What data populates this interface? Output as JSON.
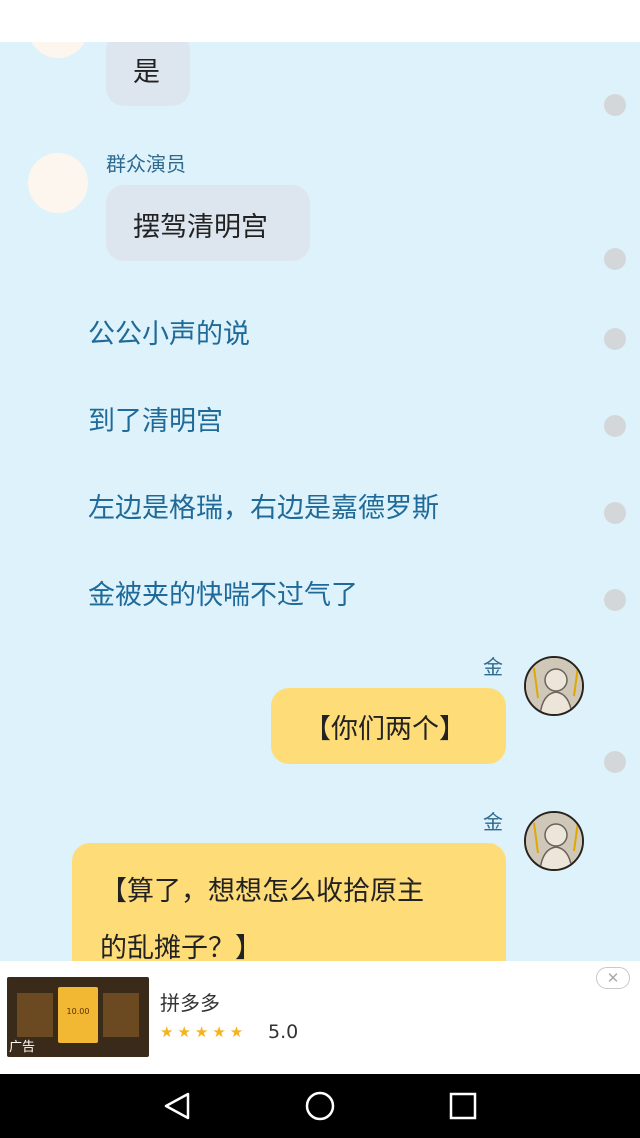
{
  "messages": {
    "m1_text": "是",
    "m2_sender": "群众演员",
    "m2_text": "摆驾清明宫",
    "narration": [
      "公公小声的说",
      "到了清明宫",
      "左边是格瑞，右边是嘉德罗斯",
      "金被夹的快喘不过气了"
    ],
    "m3_sender": "金",
    "m3_text": "【你们两个】",
    "m4_sender": "金",
    "m4_line1": "【算了，想想怎么收拾原主",
    "m4_line2": "的乱摊子？】"
  },
  "ad": {
    "label": "广告",
    "thumb_text": "10.00",
    "title": "拼多多",
    "stars": "★★★★★",
    "rating": "5.0",
    "close_icon": "close-icon"
  },
  "nav": {
    "back_icon": "back-triangle-icon",
    "home_icon": "home-circle-icon",
    "recents_icon": "recents-square-icon"
  },
  "colors": {
    "chat_bg": "#def2fb",
    "narration": "#1f6a98",
    "bubble_yellow": "#fedc78",
    "bubble_gray": "#dde6ee"
  }
}
